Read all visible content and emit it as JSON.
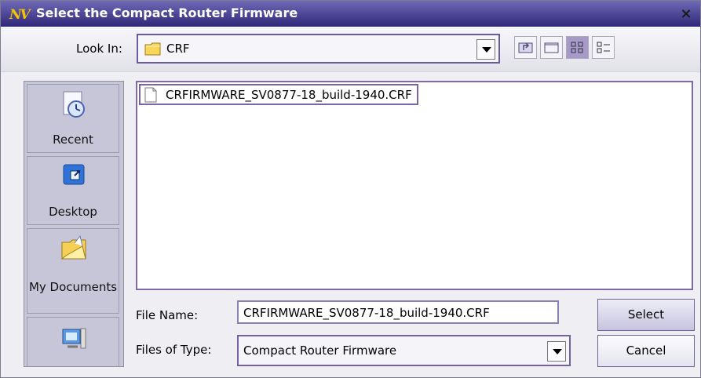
{
  "window": {
    "logo_text": "NV",
    "title": "Select the Compact Router Firmware",
    "close_glyph": "×"
  },
  "toolbar": {
    "look_in_label": "Look In:",
    "look_in_value": "CRF",
    "buttons": [
      {
        "name": "up-one-level-icon"
      },
      {
        "name": "create-new-folder-icon"
      },
      {
        "name": "list-view-icon"
      },
      {
        "name": "details-view-icon"
      }
    ]
  },
  "places": [
    {
      "label": "Recent",
      "icon": "recent-icon"
    },
    {
      "label": "Desktop",
      "icon": "desktop-icon"
    },
    {
      "label": "My Documents",
      "icon": "my-documents-icon"
    },
    {
      "label": "My Computer",
      "icon": "computer-icon"
    }
  ],
  "files": [
    {
      "name": "CRFIRMWARE_SV0877-18_build-1940.CRF",
      "icon": "file-icon"
    }
  ],
  "form": {
    "file_name_label": "File Name:",
    "file_name_value": "CRFIRMWARE_SV0877-18_build-1940.CRF",
    "file_type_label": "Files of Type:",
    "file_type_value": "Compact Router Firmware"
  },
  "actions": {
    "select_label": "Select",
    "cancel_label": "Cancel"
  },
  "colors": {
    "title_bar": "#433c94",
    "accent_border": "#6b5aa0",
    "places_background": "#c7c6d8"
  }
}
